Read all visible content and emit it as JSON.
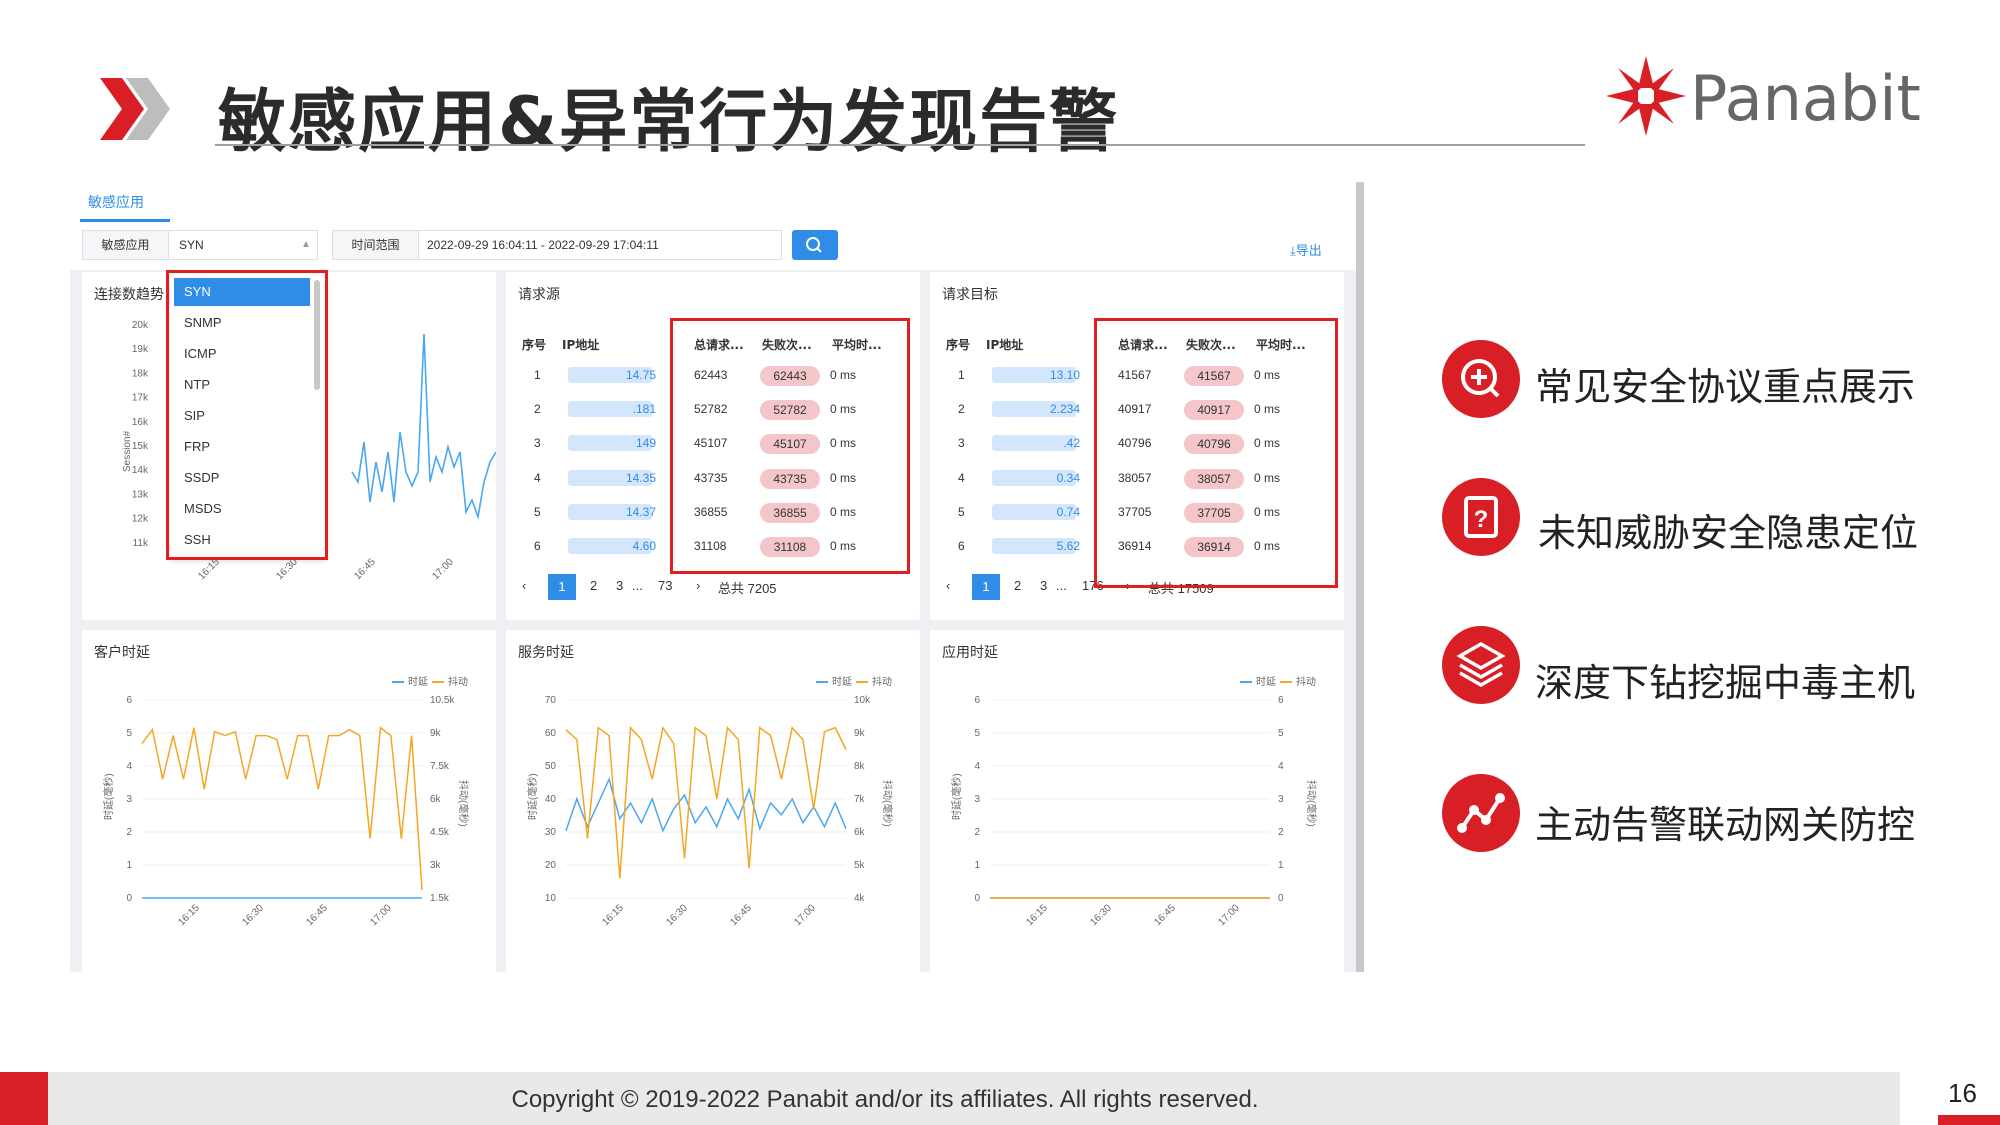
{
  "header": {
    "title": "敏感应用&异常行为发现告警",
    "logo_text": "Panabit"
  },
  "app": {
    "tab": "敏感应用",
    "filter": {
      "app_label": "敏感应用",
      "app_value": "SYN",
      "time_label": "时间范围",
      "time_value": "2022-09-29 16:04:11 - 2022-09-29 17:04:11",
      "export_label": "导出"
    },
    "dropdown": [
      "SYN",
      "SNMP",
      "ICMP",
      "NTP",
      "SIP",
      "FRP",
      "SSDP",
      "MSDS",
      "SSH"
    ],
    "trend": {
      "title": "连接数趋势",
      "ylabel": "Session#",
      "y_ticks": [
        "20k",
        "19k",
        "18k",
        "17k",
        "16k",
        "15k",
        "14k",
        "13k",
        "12k",
        "11k"
      ],
      "x_ticks": [
        "16:15",
        "16:30",
        "16:45",
        "17:00"
      ]
    },
    "source": {
      "title": "请求源",
      "headers": [
        "序号",
        "IP地址",
        "总请求...",
        "失败次...",
        "平均时..."
      ],
      "rows": [
        {
          "n": "1",
          "ip": "14.75",
          "total": "62443",
          "fail": "62443",
          "avg": "0 ms"
        },
        {
          "n": "2",
          "ip": ".181",
          "total": "52782",
          "fail": "52782",
          "avg": "0 ms"
        },
        {
          "n": "3",
          "ip": "149",
          "total": "45107",
          "fail": "45107",
          "avg": "0 ms"
        },
        {
          "n": "4",
          "ip": "14.35",
          "total": "43735",
          "fail": "43735",
          "avg": "0 ms"
        },
        {
          "n": "5",
          "ip": "14.37",
          "total": "36855",
          "fail": "36855",
          "avg": "0 ms"
        },
        {
          "n": "6",
          "ip": "4.60",
          "total": "31108",
          "fail": "31108",
          "avg": "0 ms"
        }
      ],
      "pager": {
        "active": "1",
        "p2": "2",
        "p3": "3",
        "dots": "...",
        "last": "73",
        "total": "总共 7205"
      }
    },
    "target": {
      "title": "请求目标",
      "headers": [
        "序号",
        "IP地址",
        "总请求...",
        "失败次...",
        "平均时..."
      ],
      "rows": [
        {
          "n": "1",
          "ip": "13.10",
          "total": "41567",
          "fail": "41567",
          "avg": "0 ms"
        },
        {
          "n": "2",
          "ip": "2.234",
          "total": "40917",
          "fail": "40917",
          "avg": "0 ms"
        },
        {
          "n": "3",
          "ip": ".42",
          "total": "40796",
          "fail": "40796",
          "avg": "0 ms"
        },
        {
          "n": "4",
          "ip": "0.34",
          "total": "38057",
          "fail": "38057",
          "avg": "0 ms"
        },
        {
          "n": "5",
          "ip": "0.74",
          "total": "37705",
          "fail": "37705",
          "avg": "0 ms"
        },
        {
          "n": "6",
          "ip": "5.62",
          "total": "36914",
          "fail": "36914",
          "avg": "0 ms"
        }
      ],
      "pager": {
        "active": "1",
        "p2": "2",
        "p3": "3",
        "dots": "...",
        "last": "176",
        "total": "总共 17509"
      }
    },
    "client": {
      "title": "客户时延",
      "legend1": "时延",
      "legend2": "抖动",
      "ylabel_left": "时延(毫秒)",
      "ylabel_right": "抖动(毫秒)",
      "y_left": [
        "6",
        "5",
        "4",
        "3",
        "2",
        "1",
        "0"
      ],
      "y_right": [
        "10.5k",
        "9k",
        "7.5k",
        "6k",
        "4.5k",
        "3k",
        "1.5k"
      ],
      "x_ticks": [
        "16:15",
        "16:30",
        "16:45",
        "17:00"
      ]
    },
    "server": {
      "title": "服务时延",
      "legend1": "时延",
      "legend2": "抖动",
      "ylabel_left": "时延(毫秒)",
      "ylabel_right": "抖动(毫秒)",
      "y_left": [
        "70",
        "60",
        "50",
        "40",
        "30",
        "20",
        "10"
      ],
      "y_right": [
        "10k",
        "9k",
        "8k",
        "7k",
        "6k",
        "5k",
        "4k"
      ],
      "x_ticks": [
        "16:15",
        "16:30",
        "16:45",
        "17:00"
      ]
    },
    "appdelay": {
      "title": "应用时延",
      "legend1": "时延",
      "legend2": "抖动",
      "ylabel_left": "时延(毫秒)",
      "ylabel_right": "抖动(毫秒)",
      "y_left": [
        "6",
        "5",
        "4",
        "3",
        "2",
        "1",
        "0"
      ],
      "y_right": [
        "6",
        "5",
        "4",
        "3",
        "2",
        "1",
        "0"
      ],
      "x_ticks": [
        "16:15",
        "16:30",
        "16:45",
        "17:00"
      ]
    }
  },
  "features": [
    "常见安全协议重点展示",
    "未知威胁安全隐患定位",
    "深度下钻挖掘中毒主机",
    "主动告警联动网关防控"
  ],
  "footer": {
    "copyright": "Copyright © 2019-2022 Panabit and/or its affiliates. All rights reserved.",
    "page": "16"
  },
  "colors": {
    "accent": "#d91f26",
    "blue": "#2f8de8",
    "orange": "#f5a623"
  }
}
